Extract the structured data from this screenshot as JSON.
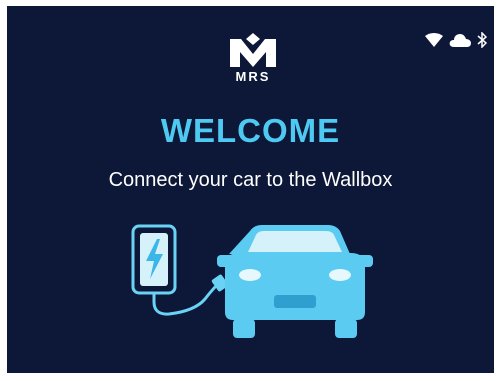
{
  "brand": {
    "logo_text": "MRS",
    "logo_icon": "mrs-logo-icon"
  },
  "status_bar": {
    "icons": [
      "wifi-icon",
      "cloud-icon",
      "bluetooth-icon"
    ]
  },
  "main": {
    "title": "WELCOME",
    "subtitle": "Connect your car to the Wallbox"
  },
  "illustration": {
    "icons": [
      "charger-icon",
      "car-icon"
    ]
  },
  "colors": {
    "background": "#0d1738",
    "accent": "#4ec9f2",
    "text": "#ffffff"
  }
}
